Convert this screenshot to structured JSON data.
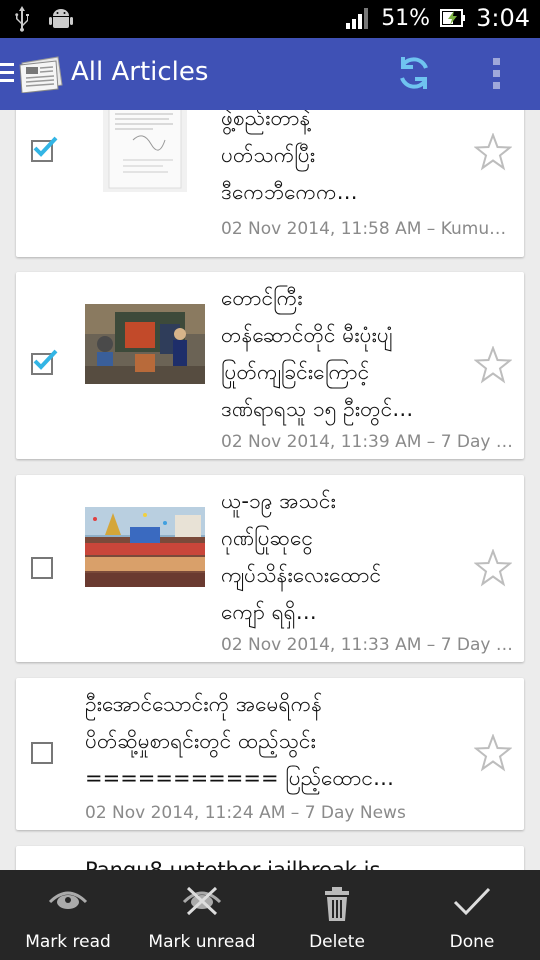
{
  "status_bar": {
    "battery_percent": "51%",
    "time": "3:04",
    "icons": [
      "usb-icon",
      "android-debug-icon",
      "signal-icon",
      "battery-charging-icon"
    ]
  },
  "app_bar": {
    "title": "All Articles",
    "icons": [
      "drawer-icon",
      "news-logo-icon",
      "refresh-icon",
      "overflow-menu-icon"
    ]
  },
  "articles": [
    {
      "title": "ဖွဲ့စည်းတာနဲ့\nပတ်သက်ပြီး\nဒီကေဘီကေက…",
      "meta": "02 Nov 2014, 11:58 AM – Kumu…",
      "checked": true,
      "has_thumbnail": true,
      "thumbnail": "document-image"
    },
    {
      "title": "တောင်ကြီး\nတန်ဆောင်တိုင် မီးပုံးပျံ\nပြုတ်ကျခြင်းကြောင့်\nဒဏ်ရာရသူ ၁၅ ဦးတွင်…",
      "meta": "02 Nov 2014, 11:39 AM – 7 Day …",
      "checked": true,
      "has_thumbnail": true,
      "thumbnail": "street-scene-image"
    },
    {
      "title": "ယူ-၁၉ အသင်း\nဂုဏ်ပြုဆုငွေ\nကျပ်သိန်းလေးထောင်\nကျော် ရရှိ…",
      "meta": "02 Nov 2014, 11:33 AM – 7 Day …",
      "checked": false,
      "has_thumbnail": true,
      "thumbnail": "crowd-celebration-image"
    },
    {
      "title": "ဦးအောင်သောင်းကို အမေရိကန်\nပိတ်ဆို့မှုစာရင်းတွင် ထည့်သွင်း\n=========== ပြည့်ထောင…",
      "meta": "02 Nov 2014, 11:24 AM – 7 Day News",
      "checked": false,
      "has_thumbnail": false
    },
    {
      "title": "Pangu8 untether jailbreak is",
      "meta": "",
      "checked": false,
      "has_thumbnail": false
    }
  ],
  "bottom_actions": [
    {
      "label": "Mark read",
      "icon": "eye-icon"
    },
    {
      "label": "Mark unread",
      "icon": "eye-crossed-icon"
    },
    {
      "label": "Delete",
      "icon": "trash-icon"
    },
    {
      "label": "Done",
      "icon": "check-icon"
    }
  ],
  "colors": {
    "app_bar": "#3f51b5",
    "status_bar": "#000000",
    "background": "#ececec",
    "checkbox_check": "#33b5e5",
    "bottom_bar": "#262626",
    "meta_text": "#8a8a8a"
  }
}
